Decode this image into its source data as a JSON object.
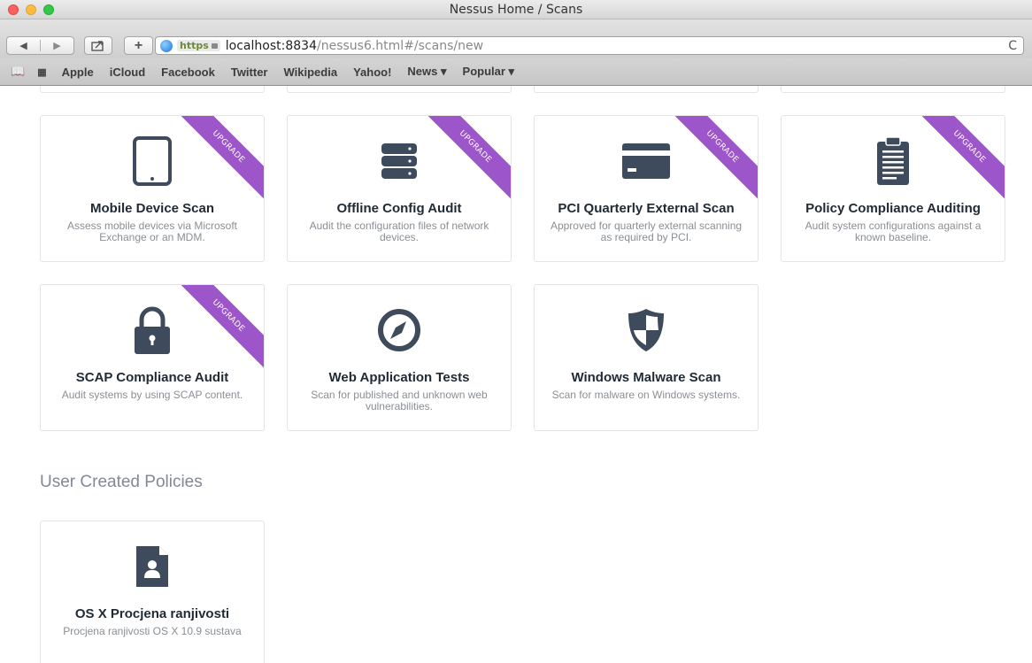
{
  "window": {
    "title": "Nessus Home / Scans"
  },
  "toolbar": {
    "back": "◀",
    "forward": "▶",
    "https": "https",
    "url_host": "localhost:8834",
    "url_path": "/nessus6.html#/scans/new",
    "reload": "C"
  },
  "bookmarks": [
    "Apple",
    "iCloud",
    "Facebook",
    "Twitter",
    "Wikipedia",
    "Yahoo!",
    "News ▾",
    "Popular ▾"
  ],
  "templates": [
    {
      "title": "Mobile Device Scan",
      "desc": "Assess mobile devices via Microsoft Exchange or an MDM.",
      "icon": "tablet-icon",
      "ribbon": "UPGRADE"
    },
    {
      "title": "Offline Config Audit",
      "desc": "Audit the configuration files of network devices.",
      "icon": "database-icon",
      "ribbon": "UPGRADE"
    },
    {
      "title": "PCI Quarterly External Scan",
      "desc": "Approved for quarterly external scanning as required by PCI.",
      "icon": "credit-card-icon",
      "ribbon": "UPGRADE"
    },
    {
      "title": "Policy Compliance Auditing",
      "desc": "Audit system configurations against a known baseline.",
      "icon": "clipboard-icon",
      "ribbon": "UPGRADE"
    },
    {
      "title": "SCAP Compliance Audit",
      "desc": "Audit systems by using SCAP content.",
      "icon": "lock-icon",
      "ribbon": "UPGRADE"
    },
    {
      "title": "Web Application Tests",
      "desc": "Scan for published and unknown web vulnerabilities.",
      "icon": "compass-icon",
      "ribbon": ""
    },
    {
      "title": "Windows Malware Scan",
      "desc": "Scan for malware on Windows systems.",
      "icon": "shield-icon",
      "ribbon": ""
    }
  ],
  "user_section": {
    "title": "User Created Policies",
    "policies": [
      {
        "title": "OS X Procjena ranjivosti",
        "desc": "Procjena ranjivosti OS X 10.9 sustava",
        "icon": "user-file-icon"
      }
    ]
  },
  "colors": {
    "icon": "#3d4b5c",
    "ribbon": "#9d56c9",
    "title": "#1f2a35",
    "desc": "#8a8f95"
  }
}
